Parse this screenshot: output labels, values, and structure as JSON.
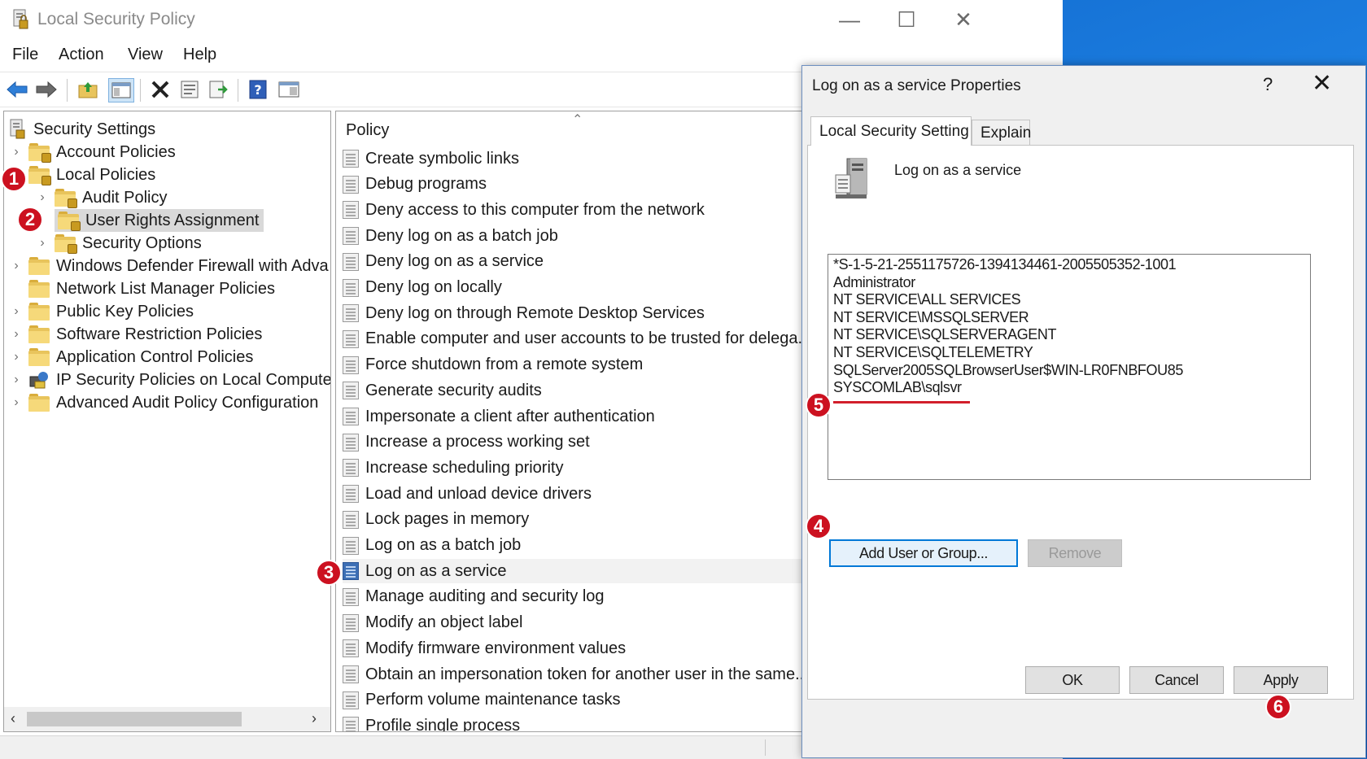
{
  "window": {
    "title": "Local Security Policy"
  },
  "menu": [
    "File",
    "Action",
    "View",
    "Help"
  ],
  "toolbar_icons": [
    "back-arrow-icon",
    "forward-arrow-icon",
    "up-folder-icon",
    "show-hide-tree-icon",
    "delete-icon",
    "properties-icon",
    "export-list-icon",
    "help-icon",
    "console-icon"
  ],
  "tree": {
    "root": "Security Settings",
    "items": [
      {
        "label": "Account Policies",
        "level": 1,
        "expandable": true
      },
      {
        "label": "Local Policies",
        "level": 1,
        "expandable": false
      },
      {
        "label": "Audit Policy",
        "level": 2,
        "expandable": true
      },
      {
        "label": "User Rights Assignment",
        "level": 2,
        "expandable": false,
        "selected": true
      },
      {
        "label": "Security Options",
        "level": 2,
        "expandable": true
      },
      {
        "label": "Windows Defender Firewall with Adva",
        "level": 1,
        "expandable": true
      },
      {
        "label": "Network List Manager Policies",
        "level": 1,
        "expandable": false
      },
      {
        "label": "Public Key Policies",
        "level": 1,
        "expandable": true
      },
      {
        "label": "Software Restriction Policies",
        "level": 1,
        "expandable": true
      },
      {
        "label": "Application Control Policies",
        "level": 1,
        "expandable": true
      },
      {
        "label": "IP Security Policies on Local Compute",
        "level": 1,
        "expandable": true
      },
      {
        "label": "Advanced Audit Policy Configuration",
        "level": 1,
        "expandable": true
      }
    ]
  },
  "policy_list": {
    "header": "Policy",
    "items": [
      "Create symbolic links",
      "Debug programs",
      "Deny access to this computer from the network",
      "Deny log on as a batch job",
      "Deny log on as a service",
      "Deny log on locally",
      "Deny log on through Remote Desktop Services",
      "Enable computer and user accounts to be trusted for delega...",
      "Force shutdown from a remote system",
      "Generate security audits",
      "Impersonate a client after authentication",
      "Increase a process working set",
      "Increase scheduling priority",
      "Load and unload device drivers",
      "Lock pages in memory",
      "Log on as a batch job",
      "Log on as a service",
      "Manage auditing and security log",
      "Modify an object label",
      "Modify firmware environment values",
      "Obtain an impersonation token for another user in the same...",
      "Perform volume maintenance tasks",
      "Profile single process"
    ]
  },
  "dialog": {
    "title": "Log on as a service Properties",
    "help": "?",
    "tabs": [
      "Local Security Setting",
      "Explain"
    ],
    "setting_name": "Log on as a service",
    "accounts": [
      "*S-1-5-21-2551175726-1394134461-2005505352-1001",
      "Administrator",
      "NT SERVICE\\ALL SERVICES",
      "NT SERVICE\\MSSQLSERVER",
      "NT SERVICE\\SQLSERVERAGENT",
      "NT SERVICE\\SQLTELEMETRY",
      "SQLServer2005SQLBrowserUser$WIN-LR0FNBFOU85",
      "SYSCOMLAB\\sqlsvr"
    ],
    "add_button": "Add User or Group...",
    "remove_button": "Remove",
    "ok_button": "OK",
    "cancel_button": "Cancel",
    "apply_button": "Apply"
  },
  "badges": [
    "1",
    "2",
    "3",
    "4",
    "5",
    "6"
  ],
  "colors": {
    "badge": "#cc1120",
    "highlight_line": "#d21f2b",
    "primary_border": "#0078d7"
  }
}
